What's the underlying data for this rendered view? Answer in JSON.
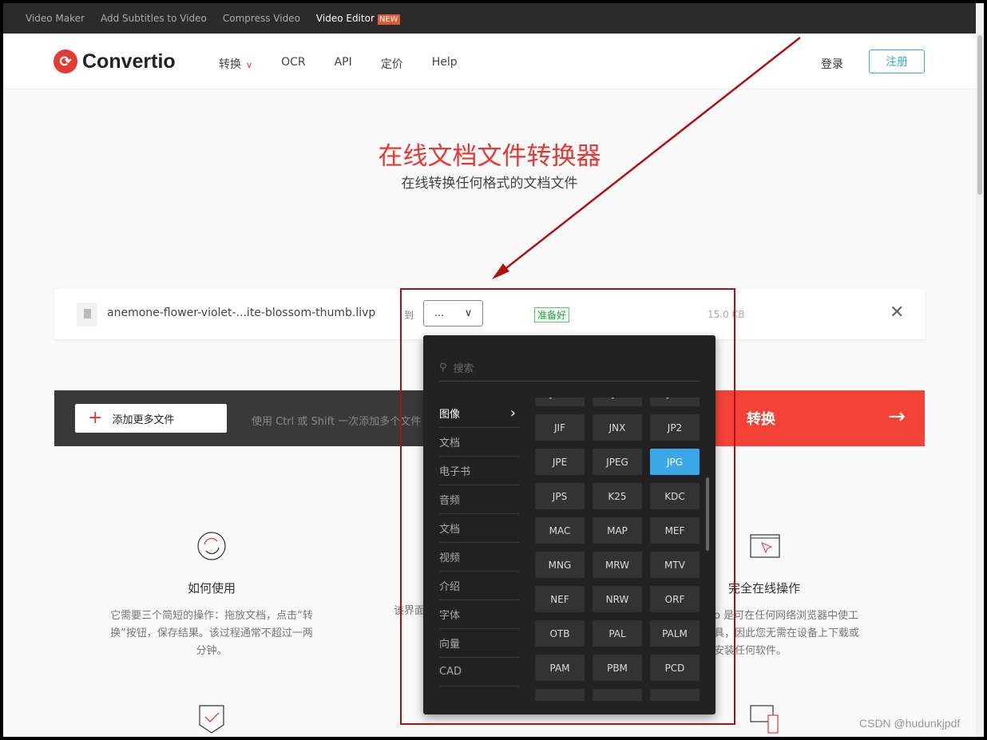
{
  "topbar": {
    "items": [
      "Video Maker",
      "Add Subtitles to Video",
      "Compress Video"
    ],
    "active": "Video Editor",
    "new_badge": "NEW"
  },
  "header": {
    "logo": "Convertio",
    "nav": [
      "转换",
      "OCR",
      "API",
      "定价",
      "Help"
    ],
    "login": "登录",
    "signup": "注册"
  },
  "hero": {
    "title": "在线文档文件转换器",
    "subtitle": "在线转换任何格式的文档文件"
  },
  "file": {
    "name": "anemone-flower-violet-...ite-blossom-thumb.livp",
    "to_label": "到",
    "selected": "...",
    "status": "准备好",
    "size": "15.0 KB"
  },
  "actions": {
    "add_more": "添加更多文件",
    "hint": "使用 Ctrl 或 Shift 一次添加多个文件",
    "convert": "转换"
  },
  "dropdown": {
    "search_placeholder": "搜索",
    "categories": [
      "图像",
      "文档",
      "电子书",
      "音频",
      "文档",
      "视频",
      "介绍",
      "字体",
      "向量",
      "CAD"
    ],
    "active_category": "图像",
    "formats": [
      "JBIG",
      "JH",
      "JHF",
      "JIF",
      "JNX",
      "JP2",
      "JPE",
      "JPEG",
      "JPG",
      "JPS",
      "K25",
      "KDC",
      "MAC",
      "MAP",
      "MEF",
      "MNG",
      "MRW",
      "MTV",
      "NEF",
      "NRW",
      "ORF",
      "OTB",
      "PAL",
      "PALM",
      "PAM",
      "PBM",
      "PCD",
      "",
      "",
      ""
    ],
    "selected_format": "JPG"
  },
  "features": [
    {
      "title": "如何使用",
      "desc": "它需要三个简短的操作：拖放文档，点击“转换”按钮，保存结果。该过程通常不超过一两分钟。"
    },
    {
      "title": "",
      "desc": "该界面"
    },
    {
      "title": "完全在线操作",
      "desc": "o 是可在任何网络浏览器中使工具，因此您无需在设备上下载或安装任何软件。"
    }
  ],
  "watermark": "CSDN @hudunkjpdf",
  "colors": {
    "accent": "#e53935",
    "convert": "#f44336",
    "selected": "#3aa8e8",
    "annotation": "#b01010"
  }
}
